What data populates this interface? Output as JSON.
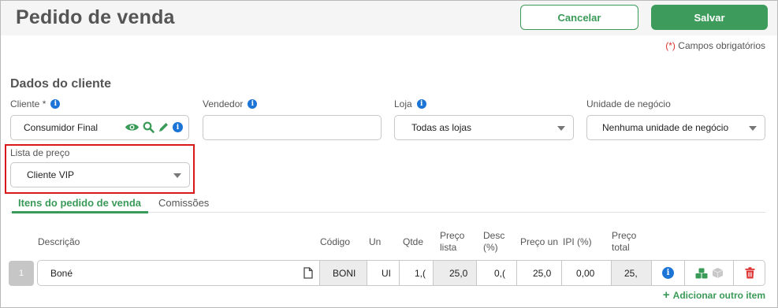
{
  "page_title": "Pedido de venda",
  "actions": {
    "cancel": "Cancelar",
    "save": "Salvar"
  },
  "required_note": {
    "asterisk": "(*)",
    "text": " Campos obrigatórios"
  },
  "customer_section": {
    "title": "Dados do cliente",
    "client": {
      "label": "Cliente",
      "required_mark": "*",
      "value": "Consumidor Final"
    },
    "seller": {
      "label": "Vendedor",
      "value": ""
    },
    "store": {
      "label": "Loja",
      "value": "Todas as lojas"
    },
    "business_unit": {
      "label": "Unidade de negócio",
      "value": "Nenhuma unidade de negócio"
    },
    "price_list": {
      "label": "Lista de preço",
      "value": "Cliente VIP"
    }
  },
  "tabs": [
    {
      "label": "Itens do pedido de venda",
      "active": true
    },
    {
      "label": "Comissões",
      "active": false
    }
  ],
  "items_table": {
    "headers": {
      "description": "Descrição",
      "code": "Código",
      "unit": "Un",
      "qty": "Qtde",
      "list_price_1": "Preço",
      "list_price_2": "lista",
      "discount_1": "Desc",
      "discount_2": "(%)",
      "unit_price": "Preço un",
      "ipi": "IPI (%)",
      "total_1": "Preço",
      "total_2": "total"
    },
    "rows": [
      {
        "index": "1",
        "description": "Boné",
        "code": "BONI",
        "unit": "UI",
        "qty": "1,(",
        "list_price": "25,0",
        "discount": "0,(",
        "unit_price": "25,0",
        "ipi": "0,00",
        "total": "25,"
      }
    ],
    "add_item": "Adicionar outro item"
  },
  "colors": {
    "accent": "#3a9a58",
    "info": "#1b74d6",
    "danger": "#d33",
    "highlight": "#d7191c"
  }
}
